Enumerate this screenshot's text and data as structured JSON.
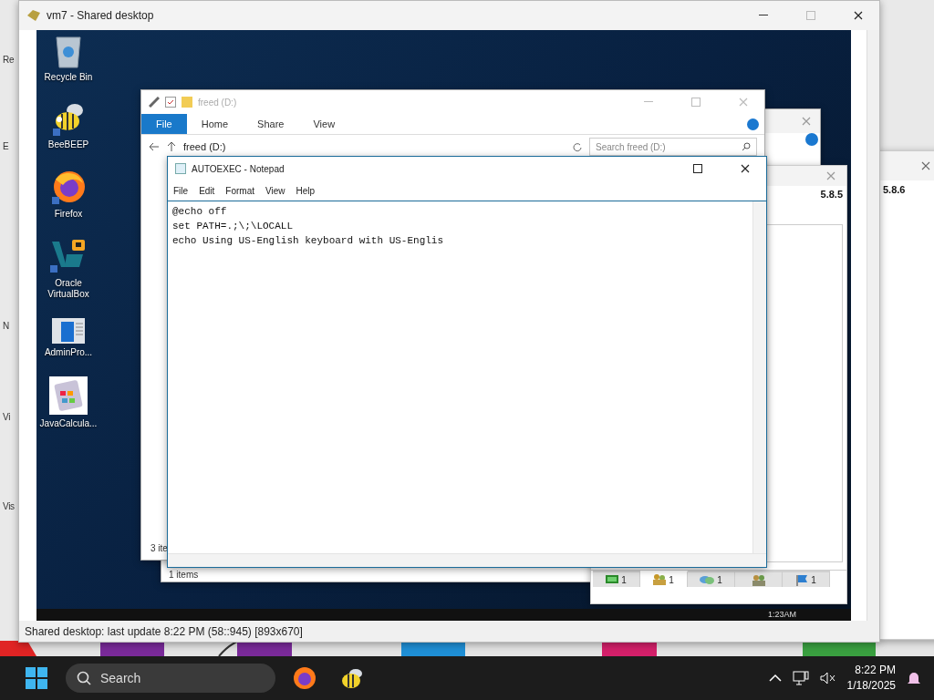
{
  "host_desktop_labels": [
    "Re",
    "E",
    "N",
    "Vi",
    "Vis"
  ],
  "host_window": {
    "title": "vm7 - Shared desktop",
    "status_bar": "Shared desktop: last update 8:22 PM (58::945) [893x670]"
  },
  "remote_desktop": {
    "icons": [
      {
        "label": "Recycle Bin",
        "kind": "recycle"
      },
      {
        "label": "BeeBEEP",
        "kind": "bee"
      },
      {
        "label": "Firefox",
        "kind": "firefox"
      },
      {
        "label": "Oracle VirtualBox",
        "kind": "virtualbox"
      },
      {
        "label": "AdminPro...",
        "kind": "window"
      },
      {
        "label": "JavaCalcula...",
        "kind": "calculator"
      }
    ]
  },
  "chat_window": {
    "version": "5.8.5",
    "tabs": [
      {
        "kind": "screen",
        "count": "1",
        "selected": false
      },
      {
        "kind": "users",
        "count": "1",
        "selected": true
      },
      {
        "kind": "chat",
        "count": "1",
        "selected": false
      },
      {
        "kind": "group",
        "selected": false
      },
      {
        "kind": "flag",
        "count": "1",
        "selected": false
      }
    ]
  },
  "explorer_back": {
    "status": "1 items"
  },
  "explorer": {
    "title": "freed (D:)",
    "ribbon_tabs": [
      {
        "label": "File",
        "selected": true
      },
      {
        "label": "Home",
        "selected": false
      },
      {
        "label": "Share",
        "selected": false
      },
      {
        "label": "View",
        "selected": false
      }
    ],
    "address": "freed (D:)",
    "search": {
      "placeholder": "Search freed (D:)"
    },
    "status": "3 ite"
  },
  "notepad": {
    "title": "AUTOEXEC - Notepad",
    "menu": [
      "File",
      "Edit",
      "Format",
      "View",
      "Help"
    ],
    "lines": [
      "@echo off",
      "set PATH=.;\\;\\LOCALL",
      "echo Using US-English keyboard with US-Englis"
    ]
  },
  "remote_taskbar": {
    "clock": "1:23AM"
  },
  "host_side_window": {
    "version": "5.8.6"
  },
  "taskbar": {
    "search": {
      "placeholder": "Search"
    },
    "time": "8:22 PM",
    "date": "1/18/2025"
  }
}
